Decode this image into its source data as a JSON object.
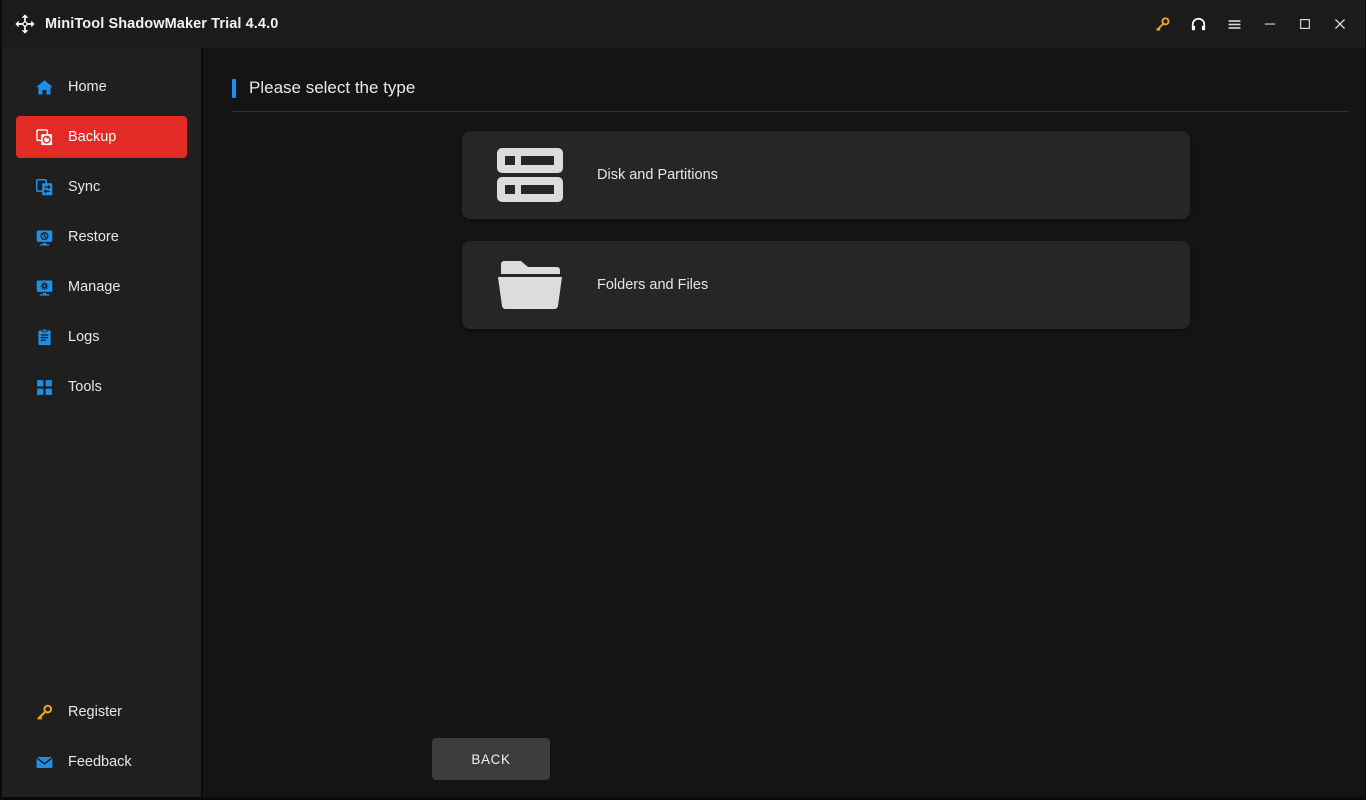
{
  "window": {
    "title": "MiniTool ShadowMaker Trial 4.4.0",
    "logo_icon": "sync-arrows-logo-icon",
    "controls": [
      {
        "name": "register-key-icon",
        "label": "Register",
        "color": "#efa41c"
      },
      {
        "name": "headset-support-icon",
        "label": "Support",
        "color": "#ffffff"
      },
      {
        "name": "hamburger-menu-icon",
        "label": "Menu",
        "color": "#d8d8d8"
      },
      {
        "name": "minimize-icon",
        "label": "Minimize",
        "color": "#e0e0e0"
      },
      {
        "name": "maximize-icon",
        "label": "Maximize",
        "color": "#e0e0e0"
      },
      {
        "name": "close-icon",
        "label": "Close",
        "color": "#e0e0e0"
      }
    ]
  },
  "sidebar": {
    "items": [
      {
        "label": "Home",
        "icon": "home-icon",
        "active": false
      },
      {
        "label": "Backup",
        "icon": "backup-icon",
        "active": true
      },
      {
        "label": "Sync",
        "icon": "sync-icon",
        "active": false
      },
      {
        "label": "Restore",
        "icon": "restore-icon",
        "active": false
      },
      {
        "label": "Manage",
        "icon": "manage-icon",
        "active": false
      },
      {
        "label": "Logs",
        "icon": "logs-icon",
        "active": false
      },
      {
        "label": "Tools",
        "icon": "tools-icon",
        "active": false
      }
    ],
    "bottom_items": [
      {
        "label": "Register",
        "icon": "key-icon",
        "color": "#efa41c"
      },
      {
        "label": "Feedback",
        "icon": "envelope-icon",
        "color": "#1e8fe8"
      }
    ]
  },
  "main": {
    "header_title": "Please select the type",
    "cards": [
      {
        "label": "Disk and Partitions",
        "icon": "disk-partitions-icon"
      },
      {
        "label": "Folders and Files",
        "icon": "folder-files-icon"
      }
    ],
    "back_label": "BACK"
  },
  "colors": {
    "accent_blue": "#1e8fe8",
    "active_red": "#e12b24",
    "key_gold": "#efa41c",
    "icon_gray": "#dcdcdc",
    "window_bg": "#141414",
    "sidebar_bg": "#1f1f1f",
    "titlebar_bg": "#1b1b1b",
    "card_bg": "#262626",
    "button_bg": "#3c3c3c"
  }
}
